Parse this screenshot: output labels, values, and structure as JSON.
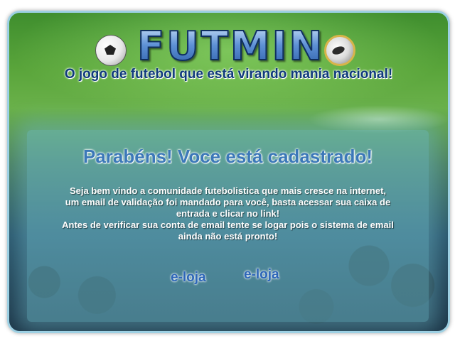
{
  "header": {
    "logo_text": "FUTMIN",
    "tagline": "O jogo de futebol que está virando mania nacional!"
  },
  "panel": {
    "title": "Parabéns! Voce está cadastrado!",
    "message_line_1": "Seja bem vindo a comunidade futebolistica que mais cresce na internet,",
    "message_line_2": "um email de validação foi mandado para você, basta acessar sua caixa de",
    "message_line_3": "entrada e clicar no link!",
    "message_line_4": "Antes de verificar sua conta de email tente se logar pois o sistema de email",
    "message_line_5": "ainda não está pronto!"
  },
  "links": [
    {
      "label": "e-loja"
    },
    {
      "label": "e-loja"
    }
  ],
  "icons": {
    "left_ball": "soccer-ball-icon",
    "right_ball": "soccer-ball-badge-icon"
  },
  "colors": {
    "accent_blue": "#3b78b8",
    "frame_border": "#9dd0e3",
    "tagline": "#0f3a7c"
  }
}
